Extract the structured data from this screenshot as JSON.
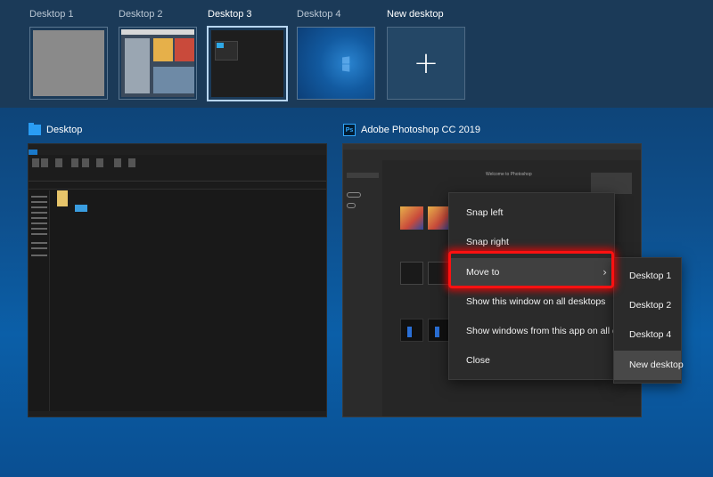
{
  "desktops": [
    {
      "label": "Desktop 1",
      "thumbnail": "gray-desktop",
      "active": false
    },
    {
      "label": "Desktop 2",
      "thumbnail": "browser-desktop",
      "active": false
    },
    {
      "label": "Desktop 3",
      "thumbnail": "dark-desktop",
      "active": true
    },
    {
      "label": "Desktop 4",
      "thumbnail": "windows-wallpaper",
      "active": false
    }
  ],
  "new_desktop": {
    "label": "New desktop",
    "icon": "plus-icon"
  },
  "windows": [
    {
      "title": "Desktop",
      "icon": "folder-icon"
    },
    {
      "title": "Adobe Photoshop CC 2019",
      "icon": "photoshop-icon",
      "icon_text": "Ps"
    }
  ],
  "photoshop_content": {
    "welcome": "Welcome to Photoshop"
  },
  "context_menu": {
    "items": [
      "Snap left",
      "Snap right",
      "Move to",
      "Show this window on all desktops",
      "Show windows from this app on all desktops",
      "Close"
    ],
    "highlighted": "Move to",
    "submenu_icon": "chevron-right-icon",
    "chevron": "›"
  },
  "submenu": {
    "items": [
      "Desktop 1",
      "Desktop 2",
      "Desktop 4",
      "New desktop"
    ],
    "highlighted": "New desktop"
  },
  "colors": {
    "highlight_box": "#ff1111",
    "menu_bg": "#2b2b2b",
    "strip_bg": "#1b3a58"
  }
}
